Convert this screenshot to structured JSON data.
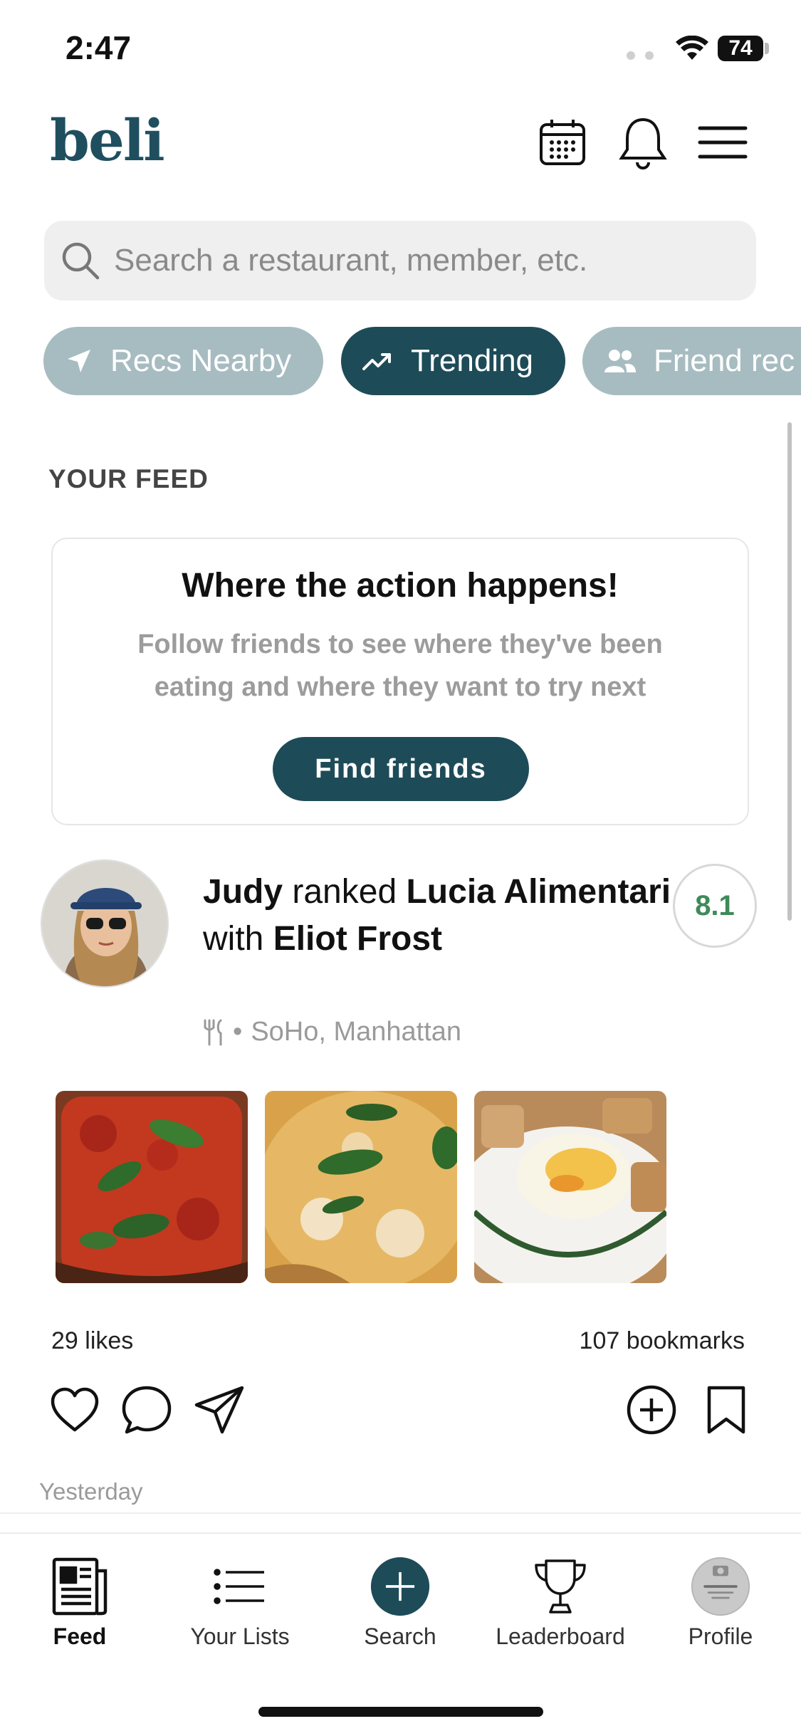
{
  "status_bar": {
    "time": "2:47",
    "battery": "74"
  },
  "header": {
    "logo": "beli",
    "icons": [
      "calendar-icon",
      "bell-icon",
      "menu-icon"
    ]
  },
  "search": {
    "placeholder": "Search a restaurant, member, etc."
  },
  "chips": [
    {
      "label": "Recs Nearby",
      "icon": "location-arrow-icon",
      "active": false
    },
    {
      "label": "Trending",
      "icon": "trending-icon",
      "active": true
    },
    {
      "label": "Friend rec",
      "icon": "people-icon",
      "active": false
    }
  ],
  "feed": {
    "section_title": "YOUR FEED",
    "empty_card": {
      "title": "Where the action happens!",
      "subtitle": "Follow friends to see where they've been eating and where they want to try next",
      "button": "Find friends"
    },
    "post": {
      "user": "Judy",
      "action": "ranked",
      "restaurant": "Lucia Alimentari",
      "with_prefix": "with",
      "companion": "Eliot Frost",
      "location": "SoHo, Manhattan",
      "score": "8.1",
      "likes": "29 likes",
      "bookmarks": "107 bookmarks",
      "timestamp": "Yesterday"
    }
  },
  "tabs": [
    {
      "label": "Feed",
      "icon": "newspaper-icon",
      "active": true
    },
    {
      "label": "Your Lists",
      "icon": "list-icon",
      "active": false
    },
    {
      "label": "Search",
      "icon": "plus-circle-icon",
      "active": false
    },
    {
      "label": "Leaderboard",
      "icon": "trophy-icon",
      "active": false
    },
    {
      "label": "Profile",
      "icon": "profile-photo-icon",
      "active": false
    }
  ],
  "colors": {
    "brand": "#1e4b58",
    "chip_inactive": "#a7bcc1",
    "score_green": "#3f8a5a"
  }
}
